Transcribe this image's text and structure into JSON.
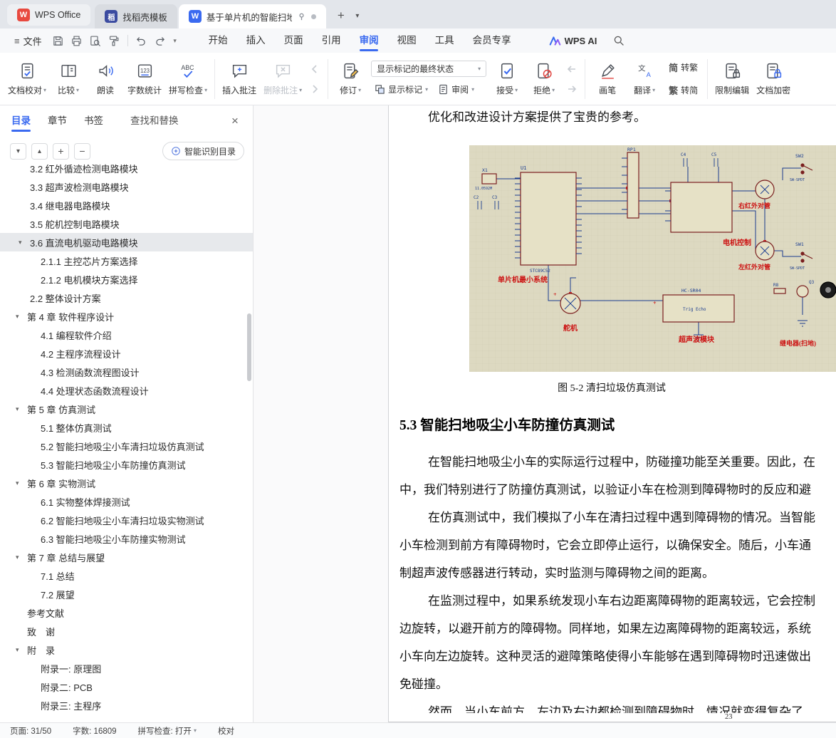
{
  "tabs": {
    "home": "WPS Office",
    "docer": "找稻壳模板",
    "doc": "基于单片机的智能扫地吸尘小..."
  },
  "menubar": {
    "file": "文件",
    "items": [
      "开始",
      "插入",
      "页面",
      "引用",
      "审阅",
      "视图",
      "工具",
      "会员专享"
    ],
    "active": "审阅",
    "ai": "WPS AI"
  },
  "ribbon": {
    "proof": "文档校对",
    "compare": "比较",
    "read": "朗读",
    "wordcount": "字数统计",
    "spell": "拼写检查",
    "insert_comment": "插入批注",
    "delete_comment": "删除批注",
    "revise": "修订",
    "markup_state": "显示标记的最终状态",
    "show_markup": "显示标记",
    "review": "审阅",
    "accept": "接受",
    "reject": "拒绝",
    "pen": "画笔",
    "translate": "翻译",
    "to_trad": "转繁",
    "to_simp": "转简",
    "trad_ch": "繁",
    "simp_ch": "简",
    "restrict": "限制编辑",
    "encrypt": "文档加密"
  },
  "sidebar": {
    "tabs": [
      "目录",
      "章节",
      "书签",
      "查找和替换"
    ],
    "active": "目录",
    "smart_toc": "智能识别目录",
    "toc": [
      {
        "label": "3.2 红外循迹检测电路模块",
        "level": 1
      },
      {
        "label": "3.3 超声波检测电路模块",
        "level": 1
      },
      {
        "label": "3.4 继电器电路模块",
        "level": 1
      },
      {
        "label": "3.5 舵机控制电路模块",
        "level": 1
      },
      {
        "label": "3.6 直流电机驱动电路模块",
        "level": 1,
        "arrow": true,
        "selected": true
      },
      {
        "label": "2.1.1 主控芯片方案选择",
        "level": 2
      },
      {
        "label": "2.1.2 电机模块方案选择",
        "level": 2
      },
      {
        "label": "2.2 整体设计方案",
        "level": 1
      },
      {
        "label": "第 4 章 软件程序设计",
        "level": 0,
        "arrow": true
      },
      {
        "label": "4.1 编程软件介绍",
        "level": 2
      },
      {
        "label": "4.2 主程序流程设计",
        "level": 2
      },
      {
        "label": "4.3 检测函数流程图设计",
        "level": 2
      },
      {
        "label": "4.4 处理状态函数流程设计",
        "level": 2
      },
      {
        "label": "第 5 章 仿真测试",
        "level": 0,
        "arrow": true
      },
      {
        "label": "5.1 整体仿真测试",
        "level": 2
      },
      {
        "label": "5.2 智能扫地吸尘小车清扫垃圾仿真测试",
        "level": 2
      },
      {
        "label": "5.3 智能扫地吸尘小车防撞仿真测试",
        "level": 2
      },
      {
        "label": "第 6 章 实物测试",
        "level": 0,
        "arrow": true
      },
      {
        "label": "6.1 实物整体焊接测试",
        "level": 2
      },
      {
        "label": "6.2 智能扫地吸尘小车清扫垃圾实物测试",
        "level": 2
      },
      {
        "label": "6.3 智能扫地吸尘小车防撞实物测试",
        "level": 2
      },
      {
        "label": "第 7 章 总结与展望",
        "level": 0,
        "arrow": true
      },
      {
        "label": "7.1 总结",
        "level": 2
      },
      {
        "label": "7.2 展望",
        "level": 2
      },
      {
        "label": "参考文献",
        "level": 0
      },
      {
        "label": "致　谢",
        "level": 0
      },
      {
        "label": "附　录",
        "level": 0,
        "arrow": true
      },
      {
        "label": "附录一: 原理图",
        "level": 2
      },
      {
        "label": "附录二: PCB",
        "level": 2
      },
      {
        "label": "附录三: 主程序",
        "level": 2
      }
    ]
  },
  "document": {
    "intro_line": "优化和改进设计方案提供了宝贵的参考。",
    "caption": "图 5-2 清扫垃圾仿真测试",
    "heading": "5.3 智能扫地吸尘小车防撞仿真测试",
    "lines": [
      {
        "text": "在智能扫地吸尘小车的实际运行过程中，防碰撞功能至关重要。因此，在",
        "indent": true
      },
      {
        "text": "中，我们特别进行了防撞仿真测试，以验证小车在检测到障碍物时的反应和避",
        "indent": false
      },
      {
        "text": "在仿真测试中，我们模拟了小车在清扫过程中遇到障碍物的情况。当智能",
        "indent": true
      },
      {
        "text": "小车检测到前方有障碍物时，它会立即停止运行，以确保安全。随后，小车通",
        "indent": false
      },
      {
        "text": "制超声波传感器进行转动，实时监测与障碍物之间的距离。",
        "indent": false
      },
      {
        "text": "在监测过程中，如果系统发现小车右边距离障碍物的距离较远，它会控制",
        "indent": true
      },
      {
        "text": "边旋转，以避开前方的障碍物。同样地，如果左边离障碍物的距离较远，系统",
        "indent": false
      },
      {
        "text": "小车向左边旋转。这种灵活的避障策略使得小车能够在遇到障碍物时迅速做出",
        "indent": false
      },
      {
        "text": "免碰撞。",
        "indent": false
      },
      {
        "text": "然而，当小车前方、左边及右边都检测到障碍物时，情况就变得复杂了。",
        "indent": true
      }
    ],
    "page_number": "23",
    "figure": {
      "labels": {
        "u1": "U1",
        "chip": "STC89C52",
        "x1": "X1",
        "xfreq": "11.0592M",
        "c2": "C2",
        "c3": "C3",
        "rp1": "RP1",
        "c4": "C4",
        "c5": "C5",
        "sw2": "SW2",
        "sw1": "SW1",
        "sw_type": "SW-SPDT",
        "module": "HC-SR04",
        "trig": "Trig Echo",
        "r8": "R8",
        "q3": "Q3",
        "mcu": "单片机最小系统",
        "motor": "电机控制",
        "ir_right": "右红外对管",
        "ir_left": "左红外对管",
        "servo": "舵机",
        "ultra": "超声波模块",
        "relay": "继电器(扫地)"
      }
    }
  },
  "status": {
    "page": "页面: 31/50",
    "words": "字数: 16809",
    "spell": "拼写检查: 打开",
    "proof": "校对"
  }
}
